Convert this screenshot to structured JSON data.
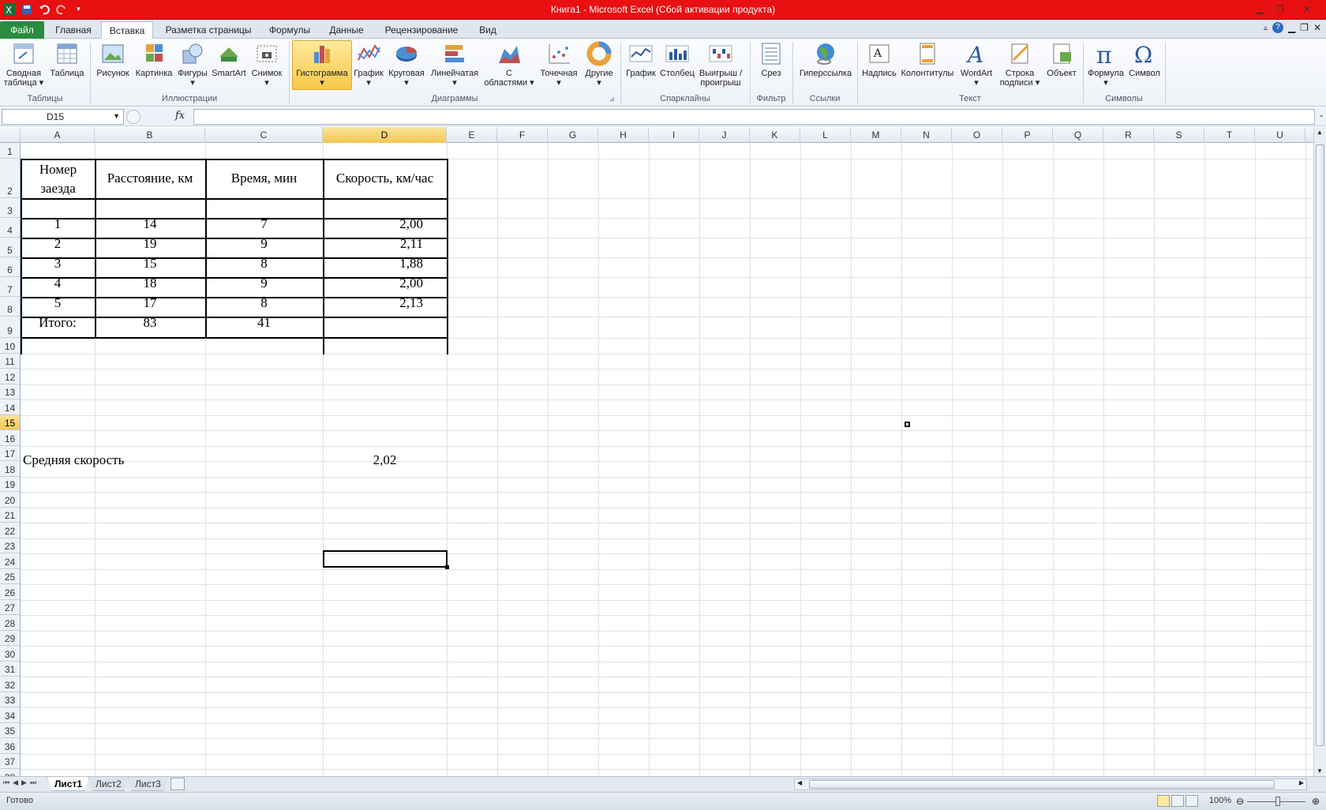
{
  "window": {
    "title": "Книга1  -  Microsoft Excel (Сбой активации продукта)"
  },
  "tabs": [
    {
      "label": "Файл"
    },
    {
      "label": "Главная"
    },
    {
      "label": "Вставка"
    },
    {
      "label": "Разметка страницы"
    },
    {
      "label": "Формулы"
    },
    {
      "label": "Данные"
    },
    {
      "label": "Рецензирование"
    },
    {
      "label": "Вид"
    }
  ],
  "ribbon": {
    "buttons": [
      {
        "l1": "Сводная",
        "l2": "таблица ▾"
      },
      {
        "l1": "Таблица",
        "l2": ""
      },
      {
        "l1": "Рисунок",
        "l2": ""
      },
      {
        "l1": "Картинка",
        "l2": ""
      },
      {
        "l1": "Фигуры",
        "l2": "▾"
      },
      {
        "l1": "SmartArt",
        "l2": ""
      },
      {
        "l1": "Снимок",
        "l2": "▾"
      },
      {
        "l1": "Гистограмма",
        "l2": "▾"
      },
      {
        "l1": "График",
        "l2": "▾"
      },
      {
        "l1": "Круговая",
        "l2": "▾"
      },
      {
        "l1": "Линейчатая",
        "l2": "▾"
      },
      {
        "l1": "С",
        "l2": "областями ▾"
      },
      {
        "l1": "Точечная",
        "l2": "▾"
      },
      {
        "l1": "Другие",
        "l2": "▾"
      },
      {
        "l1": "График",
        "l2": ""
      },
      {
        "l1": "Столбец",
        "l2": ""
      },
      {
        "l1": "Выигрыш /",
        "l2": "проигрыш"
      },
      {
        "l1": "Срез",
        "l2": ""
      },
      {
        "l1": "Гиперссылка",
        "l2": ""
      },
      {
        "l1": "Надпись",
        "l2": ""
      },
      {
        "l1": "Колонтитулы",
        "l2": ""
      },
      {
        "l1": "WordArt",
        "l2": "▾"
      },
      {
        "l1": "Строка",
        "l2": "подписи ▾"
      },
      {
        "l1": "Объект",
        "l2": ""
      },
      {
        "l1": "Формула",
        "l2": "▾"
      },
      {
        "l1": "Символ",
        "l2": ""
      }
    ],
    "groups": [
      "Таблицы",
      "Иллюстрации",
      "Диаграммы",
      "Спарклайны",
      "Фильтр",
      "Ссылки",
      "Текст",
      "Символы"
    ]
  },
  "formula_bar": {
    "name_box": "D15",
    "fx": "fx",
    "formula": ""
  },
  "columns": [
    "A",
    "B",
    "C",
    "D",
    "E",
    "F",
    "G",
    "H",
    "I",
    "J",
    "K",
    "L",
    "M",
    "N",
    "O",
    "P",
    "Q",
    "R",
    "S",
    "T",
    "U"
  ],
  "selected_cell": "D15",
  "table": {
    "header": [
      "Номер",
      "заезда",
      "Расстояние, км",
      "Время, мин",
      "Скорость, км/час"
    ],
    "rows": [
      [
        "1",
        "14",
        "7",
        "2,00"
      ],
      [
        "2",
        "19",
        "9",
        "2,11"
      ],
      [
        "3",
        "15",
        "8",
        "1,88"
      ],
      [
        "4",
        "18",
        "9",
        "2,00"
      ],
      [
        "5",
        "17",
        "8",
        "2,13"
      ]
    ],
    "total": [
      "Итого:",
      "83",
      "41",
      ""
    ],
    "avg_label": "Средняя скорость",
    "avg_value": "2,02"
  },
  "sheets": [
    "Лист1",
    "Лист2",
    "Лист3"
  ],
  "status": {
    "text": "Готово",
    "zoom": "100%"
  }
}
